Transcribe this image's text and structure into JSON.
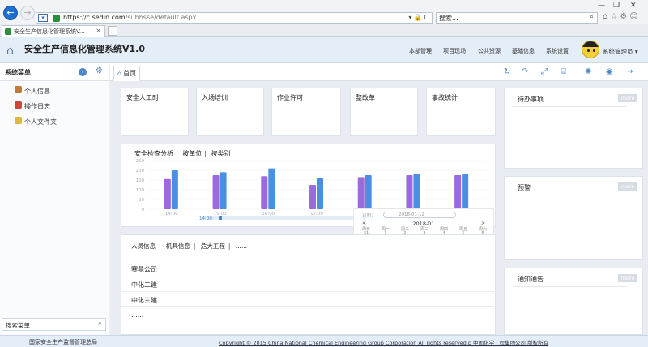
{
  "browser": {
    "url_host": "https://c.sedin.com",
    "url_path": "/subhsse/default.aspx",
    "url_tools": "▾ 🔒 C",
    "search_placeholder": "搜索...",
    "tab_title": "安全生产信息化管理系统V...",
    "tab_close": "×"
  },
  "header": {
    "title": "安全生产信息化管理系统V1.0",
    "nav": [
      "本部管理",
      "项目现场",
      "公共资源",
      "基础信息",
      "系统设置"
    ],
    "user": "系统管理员 ▾"
  },
  "sidebar": {
    "title": "系统菜单",
    "items": [
      {
        "label": "个人信息",
        "color": "#c27a3b"
      },
      {
        "label": "操作日志",
        "color": "#c94a3a"
      },
      {
        "label": "个人文件夹",
        "color": "#e0b840"
      }
    ],
    "search_label": "搜索菜单"
  },
  "tabs": {
    "home": "首页"
  },
  "stat_cards": [
    "安全人工时",
    "入场培训",
    "作业许可",
    "整改单",
    "事故统计"
  ],
  "chart_links": [
    "安全检查分析",
    "按单位",
    "按类别"
  ],
  "chart_data": {
    "type": "bar",
    "categories": [
      "14:00",
      "15:00",
      "16:00",
      "17:00",
      "18:00",
      "19:00",
      "20:00"
    ],
    "series": [
      {
        "values": [
          155,
          175,
          170,
          125,
          165,
          175,
          175
        ],
        "color": "#9b6ae0"
      },
      {
        "values": [
          200,
          190,
          210,
          160,
          175,
          180,
          180
        ],
        "color": "#4a90e2"
      }
    ],
    "yticks": [
      0,
      50,
      100,
      150,
      200,
      250
    ],
    "ylim": [
      0,
      250
    ],
    "range_start": "14:00",
    "range_end": "20:00"
  },
  "calendar": {
    "date_label": "日期：",
    "date_value": "2018-01-12",
    "year_month": "2018-01",
    "prev": "<",
    "next": ">",
    "weekdays": [
      "周日",
      "周一",
      "周二",
      "周三",
      "周四",
      "周五",
      "周六"
    ],
    "weeks": [
      [
        "31",
        "1",
        "2",
        "3",
        "4",
        "5",
        "6"
      ],
      [
        "7",
        "8",
        "9",
        "10",
        "11",
        "12",
        "13"
      ],
      [
        "14",
        "15",
        "16",
        "17",
        "18",
        "19",
        "20"
      ],
      [
        "21",
        "22",
        "23",
        "24",
        "25",
        "26",
        "27"
      ],
      [
        "28",
        "29",
        "30",
        "31",
        "1",
        "2",
        "3"
      ]
    ]
  },
  "personnel": {
    "links": [
      "人员信息",
      "机具信息",
      "危大工程",
      "......"
    ],
    "rows": [
      "赛鼎公司",
      "中化二建",
      "中化三建",
      "......"
    ]
  },
  "right_panels": [
    {
      "title": "待办事项",
      "more": "more"
    },
    {
      "title": "预警",
      "more": "more"
    },
    {
      "title": "通知通告",
      "more": "more"
    }
  ],
  "footer": {
    "left": "国家安全生产监督管理总局",
    "right": "Copyright © 2015 China National Chemical Engineering Group Corporation All rights reserved.p 中国化学工程集团公司 版权所有"
  }
}
